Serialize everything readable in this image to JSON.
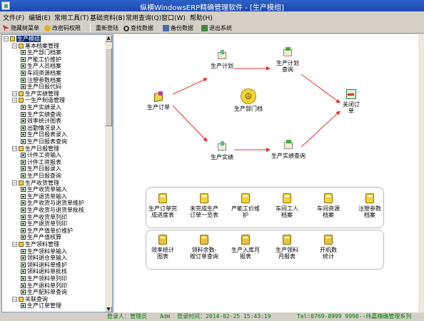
{
  "window": {
    "title": "纵横WindowsERP精确管理软件 - [生产模组]"
  },
  "menu": [
    "文件(F)",
    "编辑(E)",
    "常用工具(T)",
    "基础资料(B)",
    "常用查询(Q)",
    "窗口(W)",
    "帮助(H)"
  ],
  "toolbar": {
    "hide_tree": "隐藏树菜单",
    "change_pwd": "改密码权限",
    "relogin": "重新登陆",
    "find": "查找数据",
    "backup": "备份数据",
    "exit": "退出系统"
  },
  "tree": [
    {
      "t": "生产模组",
      "l": 0,
      "k": "root"
    },
    {
      "t": "基本档案管理",
      "l": 1,
      "k": "g"
    },
    {
      "t": "生产部门档案",
      "l": 2,
      "k": "i"
    },
    {
      "t": "产能工价维护",
      "l": 2,
      "k": "i"
    },
    {
      "t": "生产人员档案",
      "l": 2,
      "k": "i"
    },
    {
      "t": "车间资源档案",
      "l": 2,
      "k": "i"
    },
    {
      "t": "注塑参数档案",
      "l": 2,
      "k": "i"
    },
    {
      "t": "生产日报代码",
      "l": 2,
      "k": "i"
    },
    {
      "t": "生产实绩管理",
      "l": 1,
      "k": "g"
    },
    {
      "t": "一生产制造管理",
      "l": 1,
      "k": "g"
    },
    {
      "t": "生产实绩录入",
      "l": 2,
      "k": "i"
    },
    {
      "t": "生产实绩查询",
      "l": 2,
      "k": "i"
    },
    {
      "t": "效率统计图表",
      "l": 2,
      "k": "i"
    },
    {
      "t": "出勤情况录入",
      "l": 2,
      "k": "i"
    },
    {
      "t": "生产日报表录入",
      "l": 2,
      "k": "i"
    },
    {
      "t": "生产日报表查询",
      "l": 2,
      "k": "i"
    },
    {
      "t": "生产日报管理",
      "l": 1,
      "k": "g"
    },
    {
      "t": "计件工资输入",
      "l": 2,
      "k": "i"
    },
    {
      "t": "计件工资报表",
      "l": 2,
      "k": "i"
    },
    {
      "t": "生产日报录入",
      "l": 2,
      "k": "i"
    },
    {
      "t": "生产日报查询",
      "l": 2,
      "k": "i"
    },
    {
      "t": "生产收货管理",
      "l": 1,
      "k": "g"
    },
    {
      "t": "生产收货单输入",
      "l": 2,
      "k": "i"
    },
    {
      "t": "生产退货单输入",
      "l": 2,
      "k": "i"
    },
    {
      "t": "生产收货与退货单维护",
      "l": 2,
      "k": "i"
    },
    {
      "t": "生产收货与退货单批核",
      "l": 2,
      "k": "i"
    },
    {
      "t": "生产收货单列印",
      "l": 2,
      "k": "i"
    },
    {
      "t": "生产退货单列印",
      "l": 2,
      "k": "i"
    },
    {
      "t": "生产产值单价维护",
      "l": 2,
      "k": "i"
    },
    {
      "t": "生产产值核算",
      "l": 2,
      "k": "i"
    },
    {
      "t": "生产领料管理",
      "l": 1,
      "k": "g"
    },
    {
      "t": "生产领料单输入",
      "l": 2,
      "k": "i"
    },
    {
      "t": "领料退仓单输入",
      "l": 2,
      "k": "i"
    },
    {
      "t": "领料退料单维护",
      "l": 2,
      "k": "i"
    },
    {
      "t": "领料退料单批核",
      "l": 2,
      "k": "i"
    },
    {
      "t": "生产领料单列印",
      "l": 2,
      "k": "i"
    },
    {
      "t": "生产退料单列印",
      "l": 2,
      "k": "i"
    },
    {
      "t": "生产配料单查询",
      "l": 2,
      "k": "i"
    },
    {
      "t": "关联查询",
      "l": 1,
      "k": "g"
    },
    {
      "t": "生产订单管理",
      "l": 2,
      "k": "i"
    }
  ],
  "flow": {
    "order": "生产订单",
    "plan": "生产计划",
    "plan_q": "生产计划\n查询",
    "dept": "生产部门档",
    "perf": "生产实绩",
    "perf_q": "生产实绩查询",
    "close": "关闭订\n单"
  },
  "panel1": [
    "生产订单完\n成进度表",
    "未完成生产\n订单一览表",
    "产能工价维\n护",
    "车间工人\n档案",
    "车间资源\n档案",
    "注塑参数\n档案"
  ],
  "panel2": [
    "效率统计\n图表",
    "领料余数-\n按订单查询",
    "生产入库月\n报表",
    "生产领料\n月报表",
    "开机数\n统计"
  ],
  "status": {
    "login": "登录人：管理员",
    "user": "Adm",
    "time": "登录时间：2014-02-25 15:43:19",
    "tel": "Tel:0769-8999 9998--纬嘉精确管理系列"
  },
  "colors": {
    "arrow": "#e03030",
    "title_bg": "#2f62c9",
    "status_text": "#007a00"
  }
}
